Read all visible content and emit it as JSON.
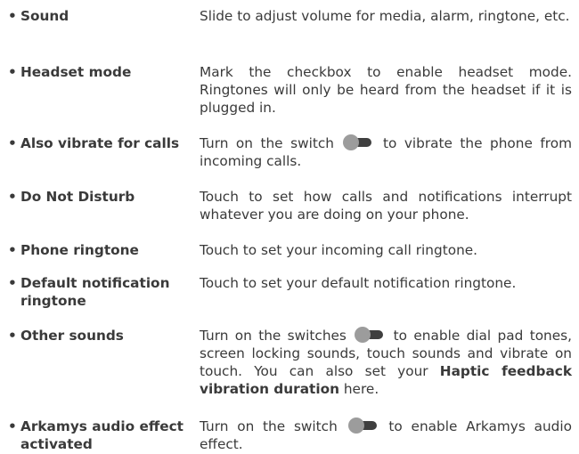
{
  "bullet": "•",
  "items": [
    {
      "term": "Sound",
      "desc": "Slide to adjust volume for media, alarm, ringtone, etc."
    },
    {
      "term": "Headset mode",
      "desc": "Mark the checkbox to enable headset mode. Ringtones will only be heard from the headset if it is plugged in."
    },
    {
      "term": "Also vibrate for calls",
      "desc_before": "Turn on the switch",
      "desc_after": "to vibrate the phone from incoming calls."
    },
    {
      "term": "Do Not Disturb",
      "desc": "Touch to set how calls and notifications interrupt whatever you are doing on your phone."
    },
    {
      "term": "Phone ringtone",
      "desc": "Touch to set your incoming call ringtone."
    },
    {
      "term": "Default notification ringtone",
      "desc": "Touch to set your default notification ringtone."
    },
    {
      "term": "Other sounds",
      "desc_before": "Turn on the switches",
      "desc_after": "to enable dial pad tones, screen locking sounds, touch sounds and vibrate on touch. You can also set your",
      "desc_bold": "Haptic feedback vibration duration",
      "desc_end": "here."
    },
    {
      "term": "Arkamys audio effect activated",
      "desc_before": "Turn on the switch",
      "desc_after": "to enable Arkamys audio effect."
    }
  ],
  "colors": {
    "text": "#3a3a3a",
    "switch_knob": "#9c9c9c",
    "switch_track": "#3f3f3f"
  },
  "icons": {
    "switch": "toggle-switch-icon"
  }
}
